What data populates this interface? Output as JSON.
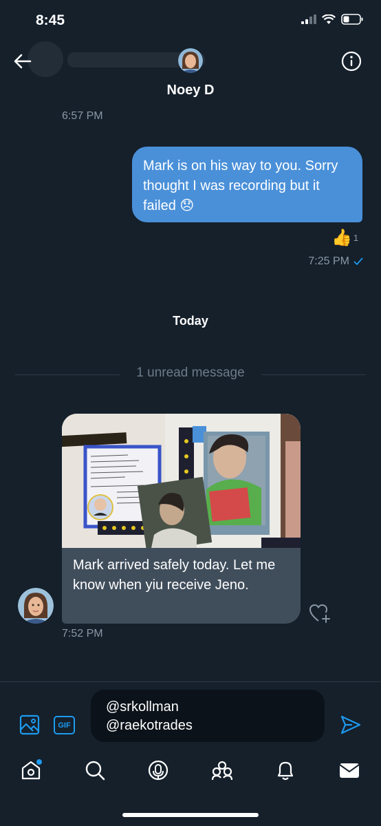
{
  "status_bar": {
    "time": "8:45"
  },
  "header": {
    "contact_name": "Noey D"
  },
  "messages": [
    {
      "timestamp": "6:57 PM"
    },
    {
      "text": "Mark is on his way to you. Sorry thought I was recording but it failed 😞",
      "reaction": "👍",
      "reaction_count": "1",
      "timestamp": "7:25 PM"
    },
    {
      "text": "Mark arrived safely today.   Let me know when yiu receive Jeno.",
      "timestamp": "7:52 PM"
    }
  ],
  "day_separator": "Today",
  "unread_divider": "1 unread message",
  "composer": {
    "gif_label": "GIF",
    "input_value": "@srkollman\n@raekotrades"
  },
  "icons": {
    "back": "arrow-left-icon",
    "info": "info-icon",
    "media": "image-icon",
    "gif": "gif-icon",
    "send": "send-icon",
    "heart_add": "heart-plus-icon",
    "nav": [
      "home-icon",
      "search-icon",
      "spaces-icon",
      "communities-icon",
      "notifications-icon",
      "messages-icon"
    ]
  },
  "colors": {
    "background": "#15202b",
    "accent": "#1d9bf0",
    "outgoing_bubble": "#4a90d9",
    "incoming_bubble": "#404e5c"
  }
}
